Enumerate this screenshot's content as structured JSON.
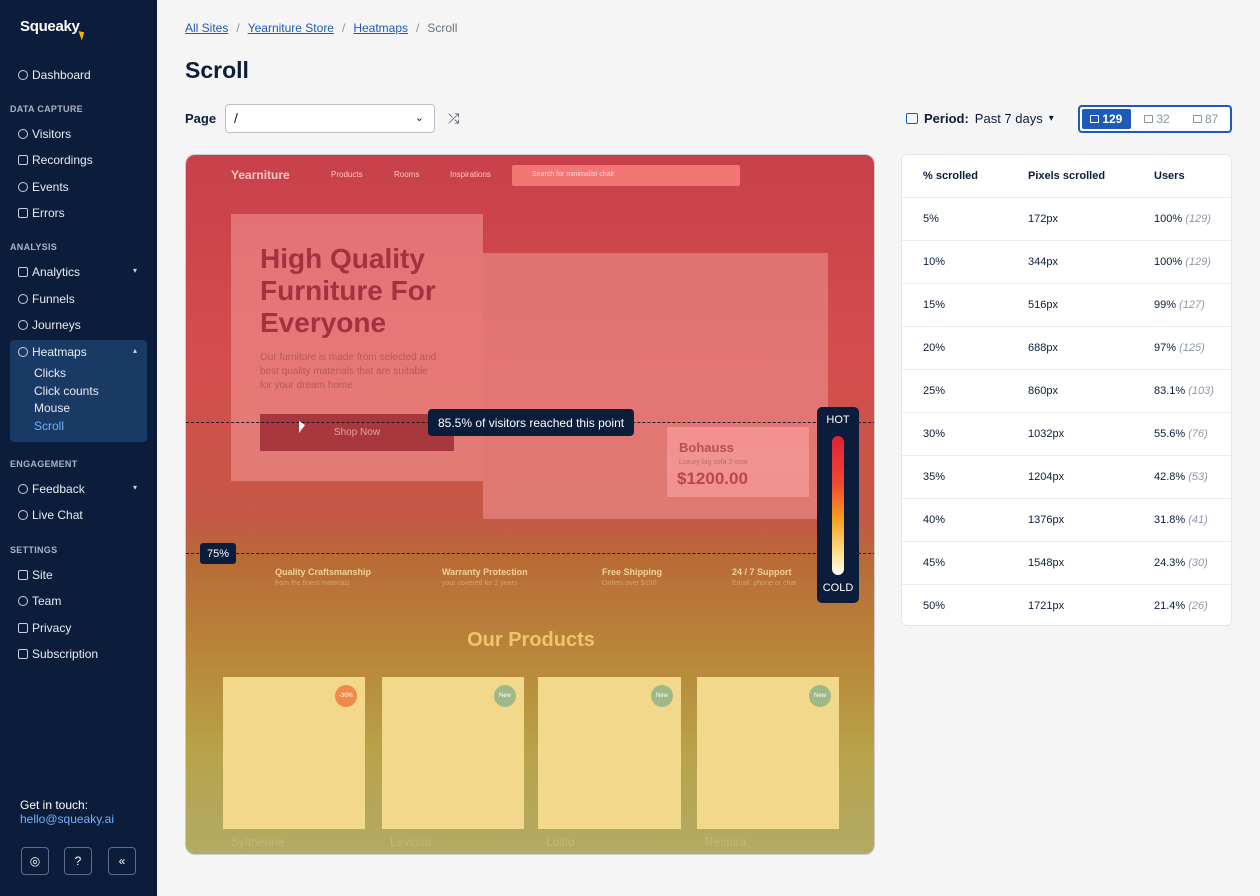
{
  "app": {
    "name": "Squeaky",
    "sidebar": {
      "dashboard": "Dashboard",
      "sections": {
        "data_capture": "DATA CAPTURE",
        "analysis": "ANALYSIS",
        "engagement": "ENGAGEMENT",
        "settings": "SETTINGS"
      },
      "data_capture_items": [
        "Visitors",
        "Recordings",
        "Events",
        "Errors"
      ],
      "analysis_items": [
        "Analytics",
        "Funnels",
        "Journeys",
        "Heatmaps"
      ],
      "heatmap_sub": [
        "Clicks",
        "Click counts",
        "Mouse",
        "Scroll"
      ],
      "engagement_items": [
        "Feedback",
        "Live Chat"
      ],
      "settings_items": [
        "Site",
        "Team",
        "Privacy",
        "Subscription"
      ],
      "contact_label": "Get in touch:",
      "contact_email": "hello@squeaky.ai"
    }
  },
  "breadcrumb": [
    "All Sites",
    "Yearniture Store",
    "Heatmaps",
    "Scroll"
  ],
  "page_title": "Scroll",
  "filter": {
    "page_label": "Page",
    "page_value": "/",
    "period_label": "Period:",
    "period_value": "Past 7 days",
    "devices": {
      "desktop": "129",
      "tablet": "32",
      "mobile": "87"
    }
  },
  "preview": {
    "site_logo": "Yearniture",
    "nav": [
      "Products",
      "Rooms",
      "Inspirations"
    ],
    "search_placeholder": "Search for minimalist chair",
    "hero_title_lines": [
      "High Quality",
      "Furniture For",
      "Everyone"
    ],
    "hero_sub": "Our furniture is made from selected and best quality materials that are suitable for your dream home",
    "shop_button": "Shop Now",
    "product_card": {
      "name": "Bohauss",
      "desc": "Luxury big sofa 2-seat",
      "price": "$1200.00"
    },
    "features": [
      {
        "title": "Quality Craftsmanship",
        "sub": "from the finest materials"
      },
      {
        "title": "Warranty Protection",
        "sub": "your covered for 2 years"
      },
      {
        "title": "Free Shipping",
        "sub": "Orders over $150"
      },
      {
        "title": "24 / 7 Support",
        "sub": "Email, phone or chat"
      }
    ],
    "section_title": "Our Products",
    "product_badges": [
      "-30%",
      "New",
      "New",
      "New"
    ],
    "product_names": [
      "Syltherine",
      "Leviosa",
      "Lolito",
      "Respira"
    ],
    "tooltip": "85.5% of visitors reached this point",
    "scroll_marker": "75%",
    "legend_hot": "HOT",
    "legend_cold": "COLD"
  },
  "table": {
    "headers": [
      "% scrolled",
      "Pixels scrolled",
      "Users"
    ],
    "rows": [
      {
        "pct": "5%",
        "px": "172px",
        "users": "100%",
        "count": "(129)"
      },
      {
        "pct": "10%",
        "px": "344px",
        "users": "100%",
        "count": "(129)"
      },
      {
        "pct": "15%",
        "px": "516px",
        "users": "99%",
        "count": "(127)"
      },
      {
        "pct": "20%",
        "px": "688px",
        "users": "97%",
        "count": "(125)"
      },
      {
        "pct": "25%",
        "px": "860px",
        "users": "83.1%",
        "count": "(103)"
      },
      {
        "pct": "30%",
        "px": "1032px",
        "users": "55.6%",
        "count": "(76)"
      },
      {
        "pct": "35%",
        "px": "1204px",
        "users": "42.8%",
        "count": "(53)"
      },
      {
        "pct": "40%",
        "px": "1376px",
        "users": "31.8%",
        "count": "(41)"
      },
      {
        "pct": "45%",
        "px": "1548px",
        "users": "24.3%",
        "count": "(30)"
      },
      {
        "pct": "50%",
        "px": "1721px",
        "users": "21.4%",
        "count": "(26)"
      }
    ]
  },
  "colors": {
    "sidebar_bg": "#0b1d3a",
    "accent": "#1e5ab8",
    "link": "#6fb1ff"
  }
}
